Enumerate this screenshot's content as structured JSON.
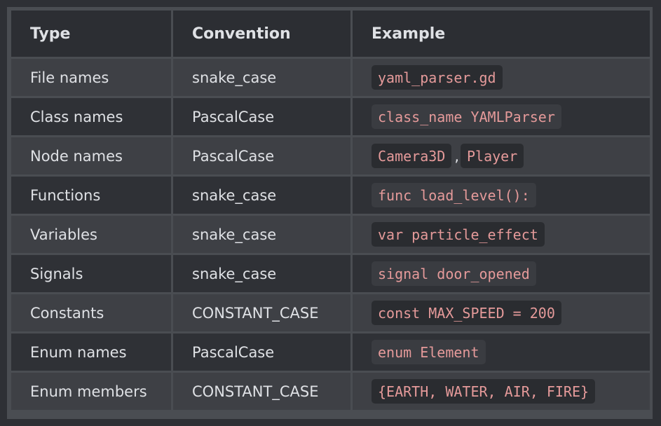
{
  "table": {
    "headers": [
      "Type",
      "Convention",
      "Example"
    ],
    "rows": [
      {
        "type": "File names",
        "convention": "snake_case",
        "example": [
          "yaml_parser.gd"
        ]
      },
      {
        "type": "Class names",
        "convention": "PascalCase",
        "example": [
          "class_name YAMLParser"
        ]
      },
      {
        "type": "Node names",
        "convention": "PascalCase",
        "example": [
          "Camera3D",
          "Player"
        ],
        "separator": ","
      },
      {
        "type": "Functions",
        "convention": "snake_case",
        "example": [
          "func load_level():"
        ]
      },
      {
        "type": "Variables",
        "convention": "snake_case",
        "example": [
          "var particle_effect"
        ]
      },
      {
        "type": "Signals",
        "convention": "snake_case",
        "example": [
          "signal door_opened"
        ]
      },
      {
        "type": "Constants",
        "convention": "CONSTANT_CASE",
        "example": [
          "const MAX_SPEED = 200"
        ]
      },
      {
        "type": "Enum names",
        "convention": "PascalCase",
        "example": [
          "enum Element"
        ]
      },
      {
        "type": "Enum members",
        "convention": "CONSTANT_CASE",
        "example": [
          "{EARTH, WATER, AIR, FIRE}"
        ]
      }
    ]
  },
  "colors": {
    "background": "#2e3035",
    "header_bg": "#2c2e33",
    "row_light": "#3e4045",
    "row_dark": "#2f3136",
    "text": "#dfe1e5",
    "code_text": "#e59a9a",
    "border": "#4a4d52"
  }
}
